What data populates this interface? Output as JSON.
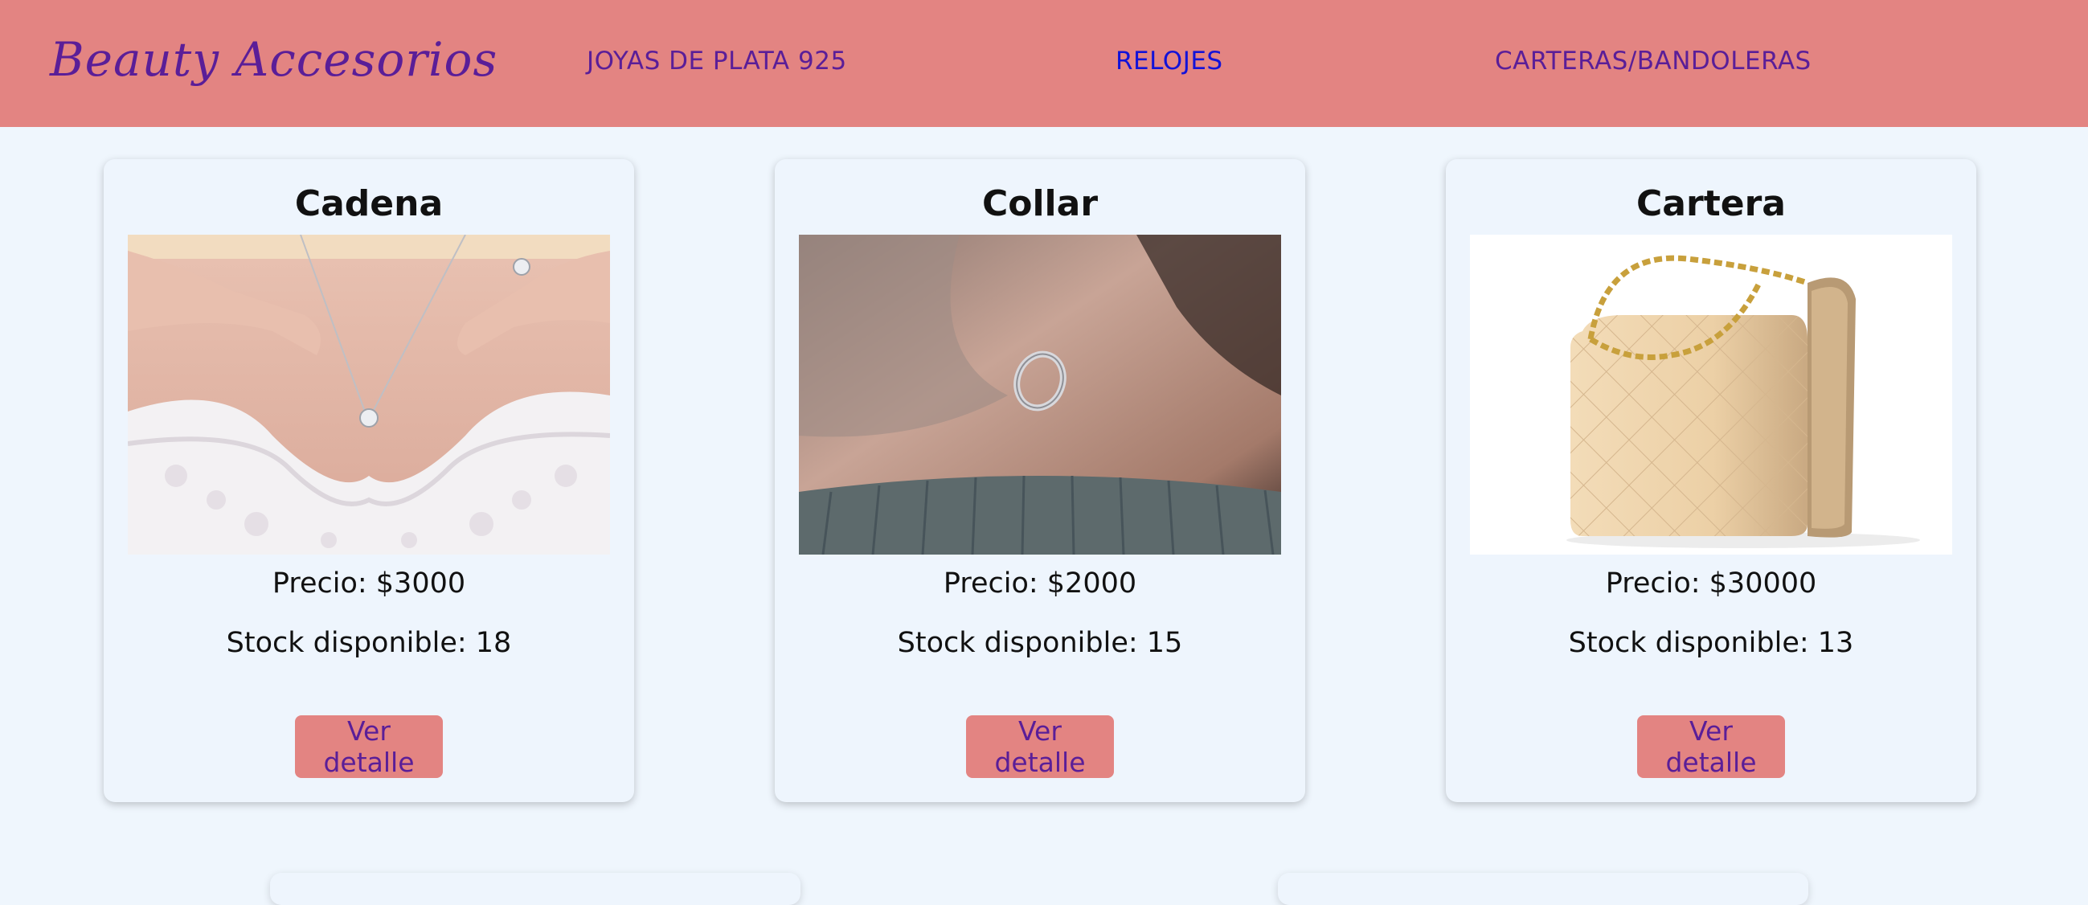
{
  "nav": {
    "brand": "Beauty Accesorios",
    "links": [
      "JOYAS DE PLATA 925",
      "RELOJES",
      "CARTERAS/BANDOLERAS"
    ],
    "active_link": "RELOJES",
    "colors": {
      "bar": "#e38482",
      "link": "#5a1e98",
      "active": "#1212d8"
    }
  },
  "products": [
    {
      "title": "Cadena",
      "price": "Precio: $3000",
      "stock": "Stock disponible: 18",
      "button": "Ver detalle",
      "image": "necklace-photo"
    },
    {
      "title": "Collar",
      "price": "Precio: $2000",
      "stock": "Stock disponible: 15",
      "button": "Ver detalle",
      "image": "ring-pendant-photo"
    },
    {
      "title": "Cartera",
      "price": "Precio: $30000",
      "stock": "Stock disponible: 13",
      "button": "Ver detalle",
      "image": "beige-handbag-photo"
    }
  ],
  "colors": {
    "page_bg": "#eff6fd",
    "button_bg": "#e38482",
    "button_text": "#5a1e98"
  }
}
